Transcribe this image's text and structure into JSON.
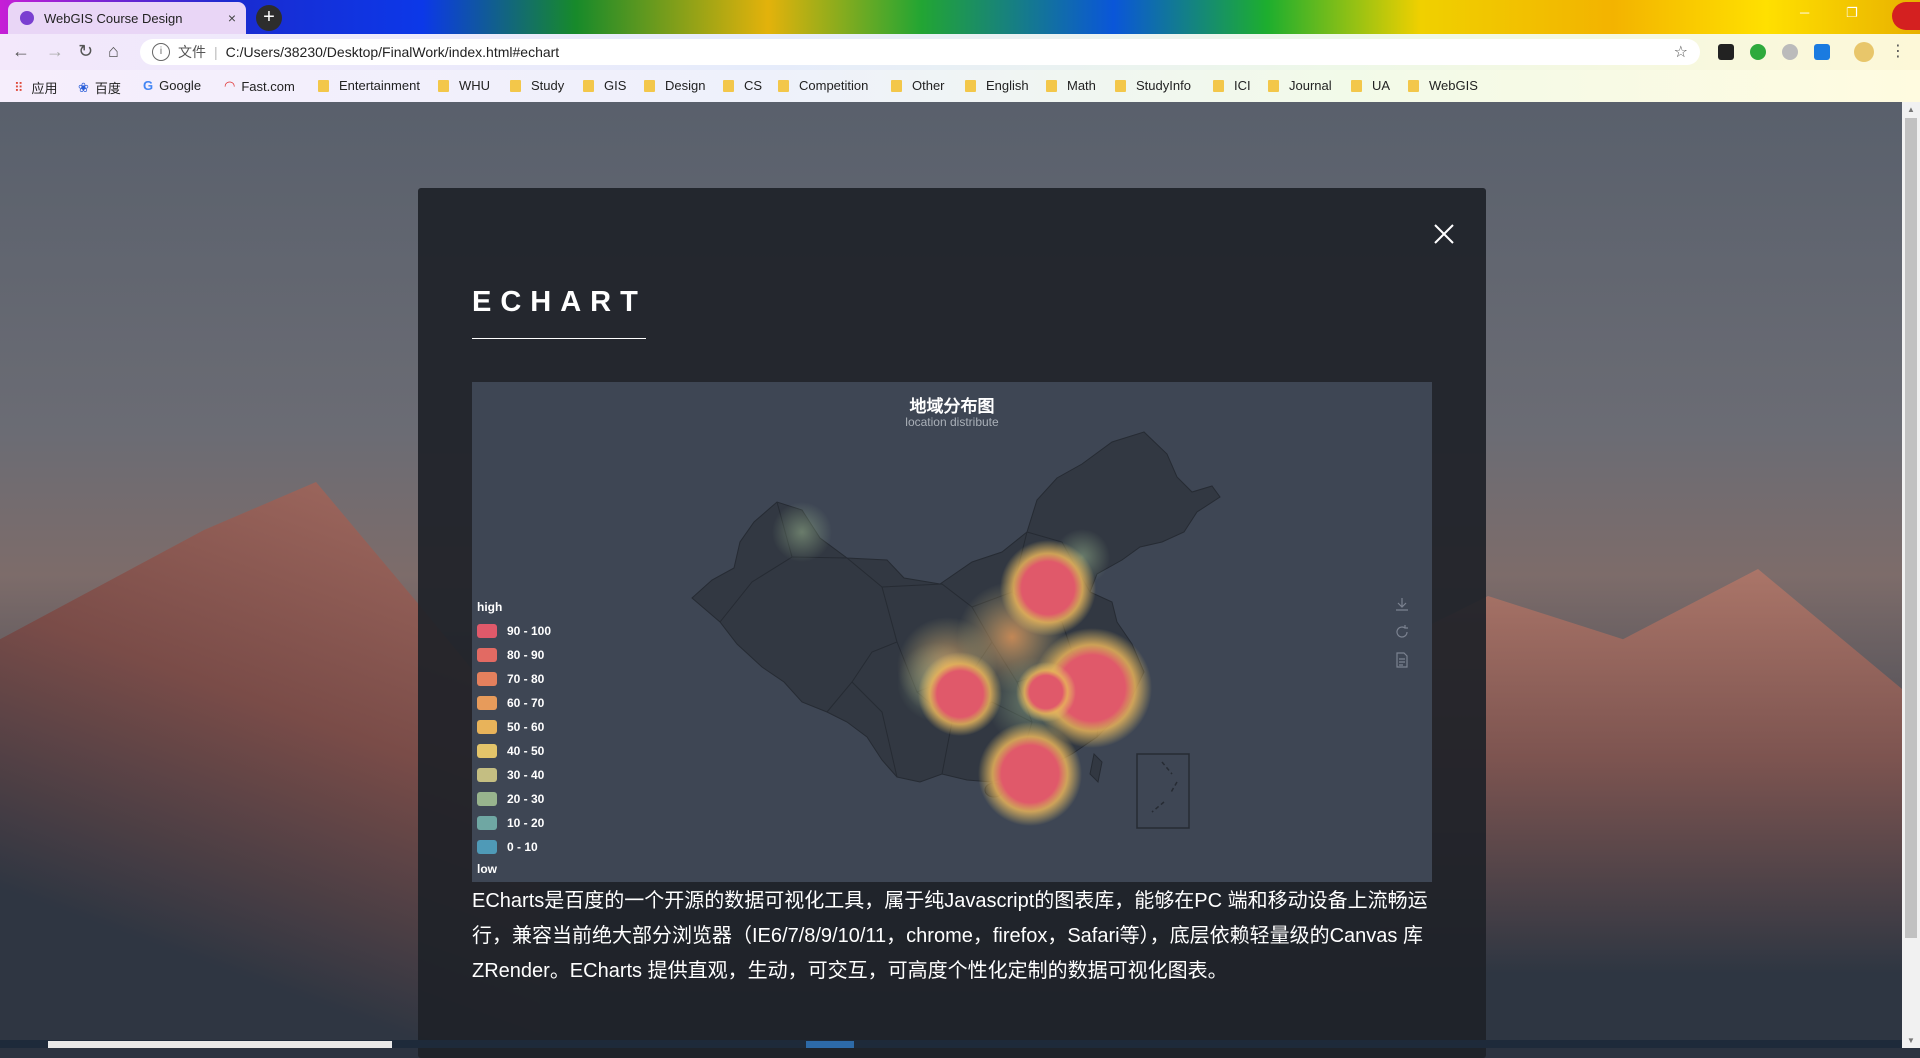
{
  "browser": {
    "tab_title": "WebGIS Course Design",
    "tab_close": "×",
    "new_tab": "+",
    "url_scheme": "文件",
    "url_sep": "|",
    "url": "C:/Users/38230/Desktop/FinalWork/index.html#echart",
    "bookmarks": [
      "应用",
      "百度",
      "Google",
      "Fast.com",
      "Entertainment",
      "WHU",
      "Study",
      "GIS",
      "Design",
      "CS",
      "Competition",
      "Other",
      "English",
      "Math",
      "StudyInfo",
      "ICI",
      "Journal",
      "UA",
      "WebGIS"
    ]
  },
  "modal": {
    "heading": "ECHART",
    "description": "ECharts是百度的一个开源的数据可视化工具，属于纯Javascript的图表库，能够在PC 端和移动设备上流畅运行，兼容当前绝大部分浏览器（IE6/7/8/9/10/11，chrome，firefox，Safari等），底层依赖轻量级的Canvas 库 ZRender。ECharts 提供直观，生动，可交互，可高度个性化定制的数据可视化图表。"
  },
  "chart_data": {
    "type": "heatmap",
    "title": "地域分布图",
    "subtitle": "location distribute",
    "legend": {
      "high_label": "high",
      "low_label": "low",
      "placement": "left",
      "pieces": [
        {
          "label": "90 - 100",
          "color": "#e0596a"
        },
        {
          "label": "80 - 90",
          "color": "#e26a63"
        },
        {
          "label": "70 - 80",
          "color": "#e4805d"
        },
        {
          "label": "60 - 70",
          "color": "#e79b5b"
        },
        {
          "label": "50 - 60",
          "color": "#e8b35a"
        },
        {
          "label": "40 - 50",
          "color": "#e3c46a"
        },
        {
          "label": "30 - 40",
          "color": "#c4be82"
        },
        {
          "label": "20 - 30",
          "color": "#98b48d"
        },
        {
          "label": "10 - 20",
          "color": "#6fa7a3"
        },
        {
          "label": "0 - 10",
          "color": "#4f9ab7"
        }
      ]
    },
    "hotspots": [
      {
        "region": "Shandong/Hebei",
        "level": 95
      },
      {
        "region": "Jiangsu/Zhejiang/Shanghai",
        "level": 95
      },
      {
        "region": "Sichuan/Chongqing",
        "level": 90
      },
      {
        "region": "Guangdong",
        "level": 95
      },
      {
        "region": "Hubei/Hunan",
        "level": 60
      },
      {
        "region": "Henan",
        "level": 50
      }
    ],
    "toolbox": [
      "download-icon",
      "refresh-icon",
      "data-view-icon"
    ]
  }
}
